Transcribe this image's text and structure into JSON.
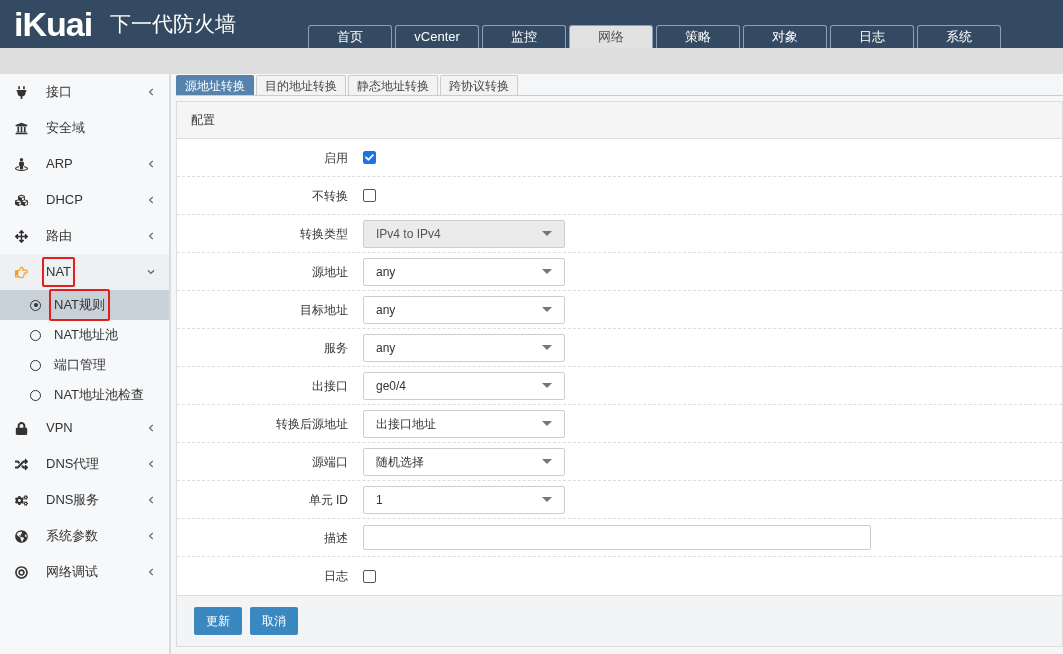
{
  "header": {
    "logo": "iKuai",
    "title": "下一代防火墙"
  },
  "top_tabs": [
    {
      "label": "首页",
      "selected": false
    },
    {
      "label": "vCenter",
      "selected": false
    },
    {
      "label": "监控",
      "selected": false
    },
    {
      "label": "网络",
      "selected": true
    },
    {
      "label": "策略",
      "selected": false
    },
    {
      "label": "对象",
      "selected": false
    },
    {
      "label": "日志",
      "selected": false
    },
    {
      "label": "系统",
      "selected": false
    }
  ],
  "sidebar": {
    "items": [
      {
        "label": "接口",
        "expandable": true,
        "expanded": false,
        "highlighted": false
      },
      {
        "label": "安全域",
        "expandable": false,
        "highlighted": false
      },
      {
        "label": "ARP",
        "expandable": true,
        "expanded": false,
        "highlighted": false
      },
      {
        "label": "DHCP",
        "expandable": true,
        "expanded": false,
        "highlighted": false
      },
      {
        "label": "路由",
        "expandable": true,
        "expanded": false,
        "highlighted": false
      },
      {
        "label": "NAT",
        "expandable": true,
        "expanded": true,
        "highlighted": true,
        "children": [
          {
            "label": "NAT规则",
            "selected": true,
            "highlighted": true
          },
          {
            "label": "NAT地址池",
            "selected": false,
            "highlighted": false
          },
          {
            "label": "端口管理",
            "selected": false,
            "highlighted": false
          },
          {
            "label": "NAT地址池检查",
            "selected": false,
            "highlighted": false
          }
        ]
      },
      {
        "label": "VPN",
        "expandable": true,
        "expanded": false,
        "highlighted": false
      },
      {
        "label": "DNS代理",
        "expandable": true,
        "expanded": false,
        "highlighted": false
      },
      {
        "label": "DNS服务",
        "expandable": true,
        "expanded": false,
        "highlighted": false
      },
      {
        "label": "系统参数",
        "expandable": true,
        "expanded": false,
        "highlighted": false
      },
      {
        "label": "网络调试",
        "expandable": true,
        "expanded": false,
        "highlighted": false
      }
    ]
  },
  "sub_tabs": [
    {
      "label": "源地址转换",
      "selected": true
    },
    {
      "label": "目的地址转换",
      "selected": false
    },
    {
      "label": "静态地址转换",
      "selected": false
    },
    {
      "label": "跨协议转换",
      "selected": false
    }
  ],
  "panel": {
    "title": "配置",
    "rows": [
      {
        "label": "启用",
        "kind": "checkbox",
        "checked": true
      },
      {
        "label": "不转换",
        "kind": "checkbox",
        "checked": false
      },
      {
        "label": "转换类型",
        "kind": "select",
        "value": "IPv4 to IPv4",
        "disabled": true
      },
      {
        "label": "源地址",
        "kind": "select",
        "value": "any",
        "disabled": false
      },
      {
        "label": "目标地址",
        "kind": "select",
        "value": "any",
        "disabled": false
      },
      {
        "label": "服务",
        "kind": "select",
        "value": "any",
        "disabled": false
      },
      {
        "label": "出接口",
        "kind": "select",
        "value": "ge0/4",
        "disabled": false
      },
      {
        "label": "转换后源地址",
        "kind": "select",
        "value": "出接口地址",
        "disabled": false
      },
      {
        "label": "源端口",
        "kind": "select",
        "value": "随机选择",
        "disabled": false
      },
      {
        "label": "单元 ID",
        "kind": "select",
        "value": "1",
        "disabled": false
      },
      {
        "label": "描述",
        "kind": "text"
      },
      {
        "label": "日志",
        "kind": "checkbox",
        "checked": false
      }
    ],
    "buttons": [
      "更新",
      "取消"
    ]
  }
}
